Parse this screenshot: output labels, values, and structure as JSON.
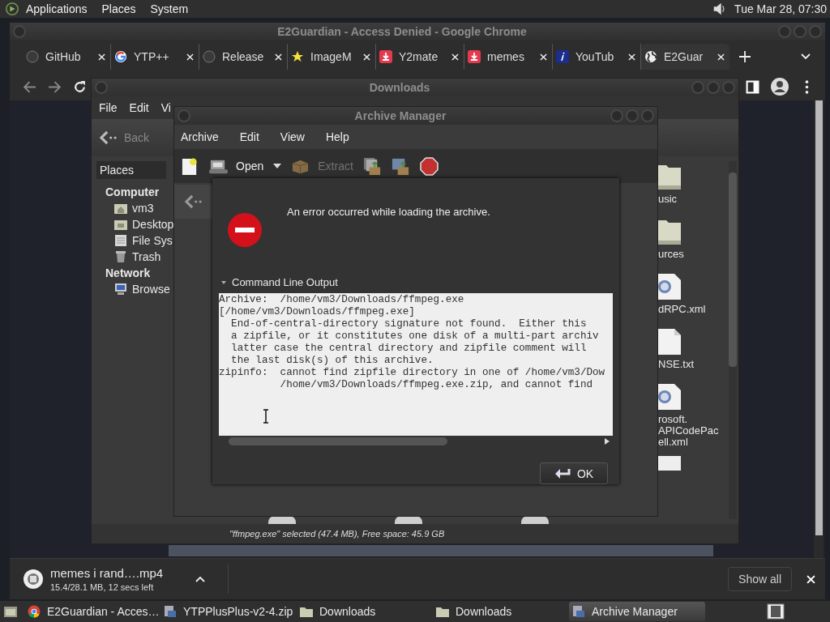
{
  "top_panel": {
    "menus": [
      "Applications",
      "Places",
      "System"
    ],
    "clock": "Tue Mar 28, 07:30"
  },
  "browser": {
    "title": "E2Guardian - Access Denied - Google Chrome",
    "tabs": [
      {
        "label": "GitHub",
        "kind": "github",
        "selected": false
      },
      {
        "label": "YTP++",
        "kind": "google",
        "selected": false
      },
      {
        "label": "Release",
        "kind": "github",
        "selected": false
      },
      {
        "label": "ImageM",
        "kind": "star",
        "selected": false
      },
      {
        "label": "Y2mate",
        "kind": "download",
        "selected": false
      },
      {
        "label": "memes",
        "kind": "download",
        "selected": false
      },
      {
        "label": "YouTub",
        "kind": "info",
        "selected": false
      },
      {
        "label": "E2Guar",
        "kind": "globe",
        "selected": true
      }
    ],
    "download_shelf": {
      "file": "memes i rand….mp4",
      "progress": "15.4/28.1 MB, 12 secs left",
      "show_all": "Show all"
    }
  },
  "file_manager": {
    "title": "Downloads",
    "menus": [
      "File",
      "Edit",
      "Vi"
    ],
    "back": "Back",
    "places_header": "Places",
    "sidebar": [
      {
        "kind": "heading",
        "label": "Computer"
      },
      {
        "kind": "home",
        "label": "vm3"
      },
      {
        "kind": "desktop",
        "label": "Desktop"
      },
      {
        "kind": "drive",
        "label": "File Sys"
      },
      {
        "kind": "trash",
        "label": "Trash"
      },
      {
        "kind": "heading",
        "label": "Network"
      },
      {
        "kind": "network",
        "label": "Browse"
      }
    ],
    "files": [
      {
        "label": "usic",
        "kind": "folder"
      },
      {
        "label": "urces",
        "kind": "folder"
      },
      {
        "label": "dRPC.xml",
        "kind": "web"
      },
      {
        "label": "NSE.txt",
        "kind": "text"
      },
      {
        "label": "rosoft.\nAPICodePac\nell.xml",
        "kind": "web"
      }
    ],
    "status": "\"ffmpeg.exe\" selected (47.4 MB), Free space: 45.9 GB"
  },
  "archive_manager": {
    "title": "Archive Manager",
    "menus": [
      "Archive",
      "Edit",
      "View",
      "Help"
    ],
    "toolbar": [
      {
        "kind": "new",
        "disabled": false
      },
      {
        "kind": "open",
        "label": "Open",
        "disabled": false
      },
      {
        "kind": "extract",
        "label": "Extract",
        "disabled": true
      },
      {
        "kind": "add-files",
        "disabled": false
      },
      {
        "kind": "add-folder",
        "disabled": false
      },
      {
        "kind": "stop",
        "disabled": false
      }
    ]
  },
  "error_dialog": {
    "message": "An error occurred while loading the archive.",
    "expander": {
      "label": "Command Line Output",
      "expanded": true
    },
    "output": [
      "Archive:  /home/vm3/Downloads/ffmpeg.exe",
      "[/home/vm3/Downloads/ffmpeg.exe]",
      "  End-of-central-directory signature not found.  Either this",
      "  a zipfile, or it constitutes one disk of a multi-part archiv",
      "  latter case the central directory and zipfile comment will",
      "  the last disk(s) of this archive.",
      "zipinfo:  cannot find zipfile directory in one of /home/vm3/Dow",
      "          /home/vm3/Downloads/ffmpeg.exe.zip, and cannot find"
    ],
    "ok": "OK"
  },
  "taskbar": [
    {
      "label": "E2Guardian - Acces…",
      "kind": "chrome",
      "selected": false
    },
    {
      "label": "YTPPlusPlus-v2-4.zip",
      "kind": "archive",
      "selected": false
    },
    {
      "label": "Downloads",
      "kind": "folder",
      "selected": false
    },
    {
      "label": "Downloads",
      "kind": "folder",
      "selected": false
    },
    {
      "label": "Archive Manager",
      "kind": "archive",
      "selected": true
    }
  ]
}
